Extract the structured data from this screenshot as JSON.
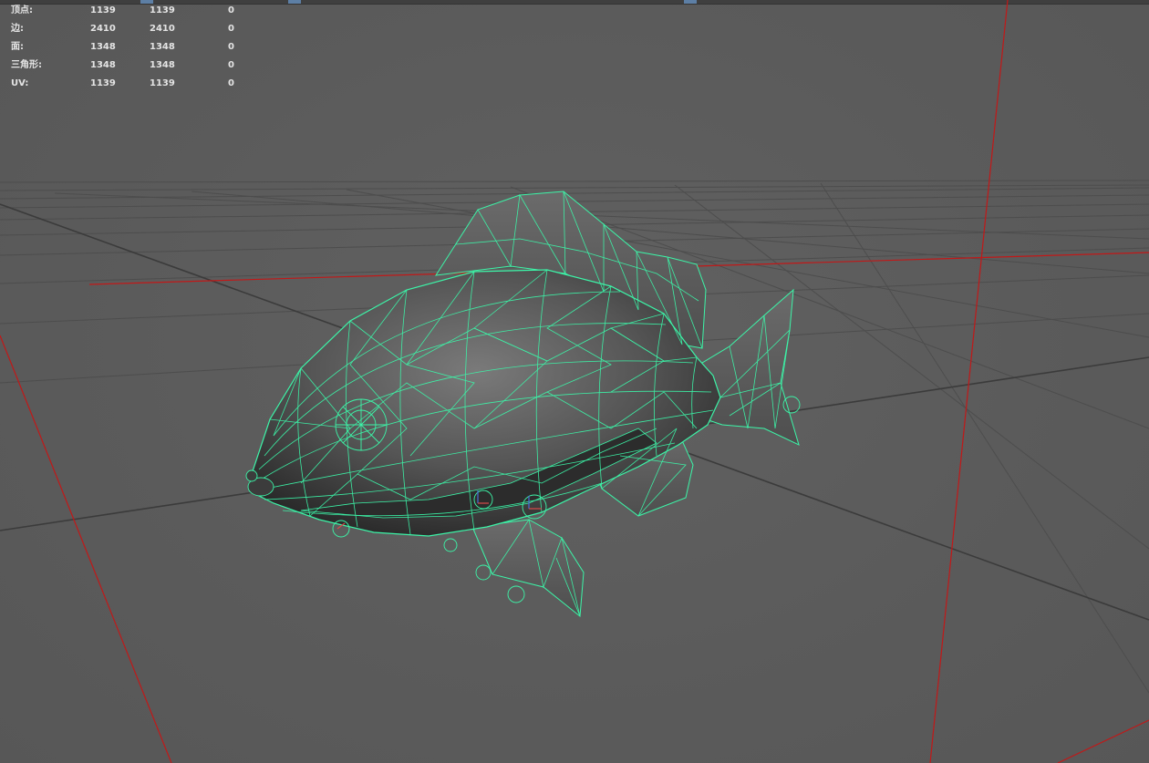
{
  "viewport": {
    "background": "#5b5b5b",
    "grid_color": "#4a4a4a",
    "axis_color": "#3d3d3d",
    "red_axis_color": "#c21818",
    "wireframe_color": "#3cf5a8",
    "selection_color": "#5d7fa5"
  },
  "hud": {
    "rows": [
      {
        "label": "顶点:",
        "a": "1139",
        "b": "1139",
        "c": "0"
      },
      {
        "label": "边:",
        "a": "2410",
        "b": "2410",
        "c": "0"
      },
      {
        "label": "面:",
        "a": "1348",
        "b": "1348",
        "c": "0"
      },
      {
        "label": "三角形:",
        "a": "1348",
        "b": "1348",
        "c": "0"
      },
      {
        "label": "UV:",
        "a": "1139",
        "b": "1139",
        "c": "0"
      }
    ]
  },
  "model": {
    "icon": "fish-wireframe-mesh"
  }
}
